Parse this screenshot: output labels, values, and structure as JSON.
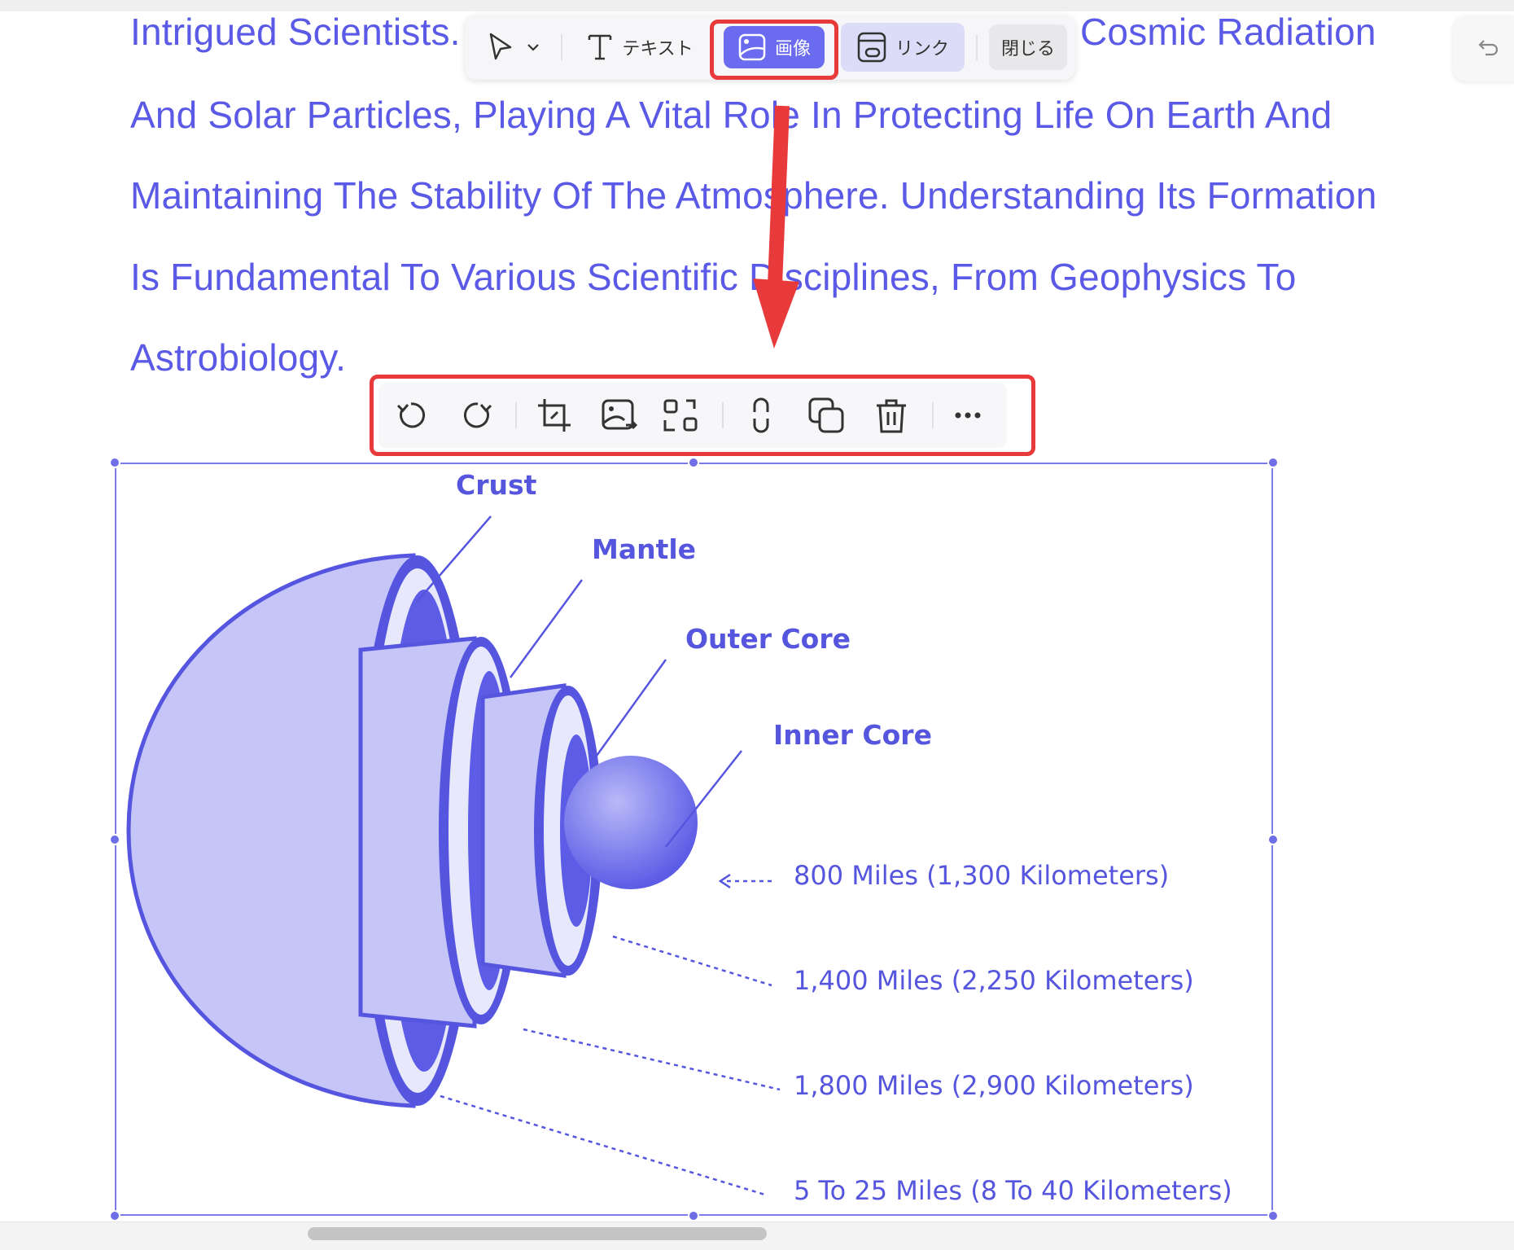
{
  "document": {
    "lines": [
      "Intrigued Scientists.",
      "Cosmic Radiation",
      "And Solar Particles, Playing A Vital Role In Protecting Life On Earth And",
      "Maintaining The Stability Of The Atmosphere. Understanding Its Formation",
      "Is Fundamental To Various Scientific Disciplines, From Geophysics To",
      "Astrobiology."
    ]
  },
  "toolbar": {
    "text_label": "テキスト",
    "image_label": "画像",
    "link_label": "リンク",
    "close_label": "閉じる"
  },
  "image_toolbar": {
    "icons": [
      "rotate-left-icon",
      "rotate-right-icon",
      "crop-icon",
      "replace-image-icon",
      "extract-image-icon",
      "link-icon",
      "duplicate-icon",
      "delete-icon",
      "more-icon"
    ]
  },
  "figure": {
    "labels": {
      "crust": "Crust",
      "mantle": "Mantle",
      "outer_core": "Outer Core",
      "inner_core": "Inner Core"
    },
    "distances": [
      "800 Miles (1,300 Kilometers)",
      "1,400 Miles (2,250 Kilometers)",
      "1,800 Miles (2,900 Kilometers)",
      "5 To 25 Miles (8 To 40 Kilometers)"
    ]
  },
  "colors": {
    "text_blue": "#5a5ae6",
    "accent": "#6b6bf0",
    "highlight_red": "#e8393b",
    "earth_light": "#c5c5f7",
    "earth_dark": "#5555e0"
  }
}
